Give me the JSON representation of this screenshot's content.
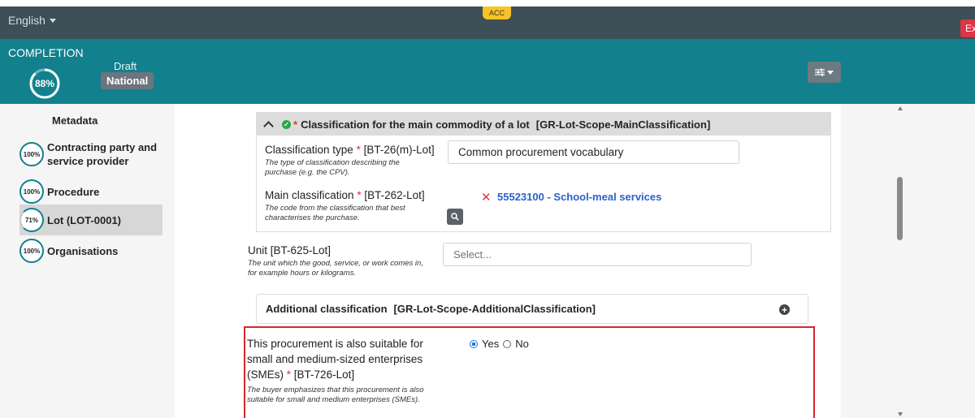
{
  "header": {
    "language": "English",
    "environment_badge": "ACC",
    "exit_label": "Exit"
  },
  "status": {
    "completion_label": "COMPLETION",
    "completion_percent_text": "88%",
    "completion_fraction": 0.88,
    "draft_label": "Draft",
    "scope_badge": "National",
    "filter_icon": "sliders-icon"
  },
  "sidebar": {
    "items": [
      {
        "label": "Metadata",
        "percent": ""
      },
      {
        "label": "Contracting party and service provider",
        "percent": "100%"
      },
      {
        "label": "Procedure",
        "percent": "100%"
      },
      {
        "label": "Lot (LOT-0001)",
        "percent": "71%"
      },
      {
        "label": "Organisations",
        "percent": "100%"
      }
    ]
  },
  "main_classification": {
    "title": "Classification for the main commodity of a lot",
    "group_code": "[GR-Lot-Scope-MainClassification]",
    "type_label": "Classification type",
    "type_code": "[BT-26(m)-Lot]",
    "type_hint": "The type of classification describing the purchase (e.g. the CPV).",
    "type_value": "Common procurement vocabulary",
    "main_label": "Main classification",
    "main_code": "[BT-262-Lot]",
    "main_hint": "The code from the classification that best characterises the purchase.",
    "main_value": "55523100 - School-meal services"
  },
  "unit": {
    "label": "Unit [BT-625-Lot]",
    "hint": "The unit which the good, service, or work comes in, for example hours or kilograms.",
    "placeholder": "Select..."
  },
  "additional": {
    "title": "Additional classification",
    "group_code": "[GR-Lot-Scope-AdditionalClassification]"
  },
  "sme": {
    "label": "This procurement is also suitable for small and medium-sized enterprises (SMEs)",
    "code": "[BT-726-Lot]",
    "hint": "The buyer emphasizes that this procurement is also suitable for small and medium enterprises (SMEs).",
    "yes_label": "Yes",
    "no_label": "No",
    "selected": "Yes"
  },
  "required_marker": "*",
  "colors": {
    "topbar": "#3d4f57",
    "statusbar": "#13808d",
    "required": "#dc3545",
    "link": "#2a62c9",
    "highlight_border": "#d9262c"
  }
}
